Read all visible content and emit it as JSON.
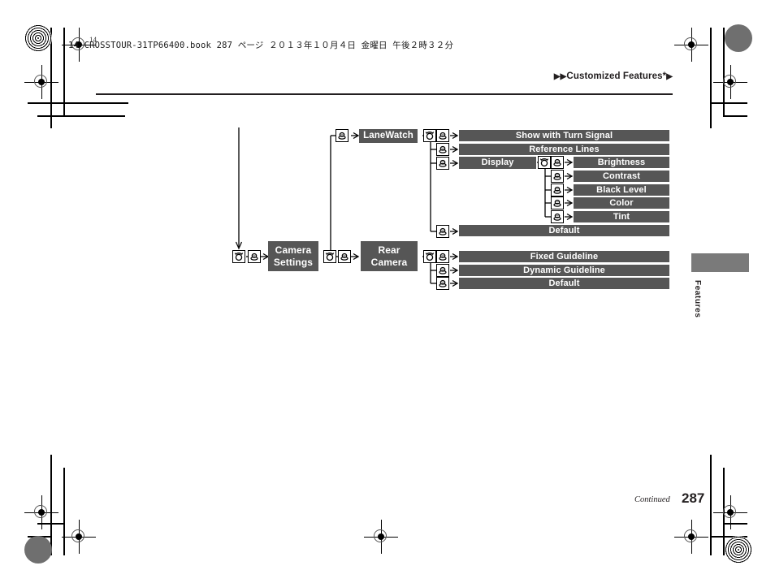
{
  "page": {
    "filestamp": "14 CROSSTOUR-31TP66400.book   287 ページ   ２０１３年１０月４日   金曜日   午後２時３２分",
    "corner_number": "14",
    "header_title": "Customized Features",
    "header_asterisk": "*",
    "header_prefix_arrows": "▶▶",
    "header_suffix_arrow": "▶",
    "side_tab_label": "Features",
    "continued_label": "Continued",
    "page_number": "287"
  },
  "colors": {
    "node_fill": "#565656",
    "node_text": "#ffffff",
    "rule": "#231f20",
    "tab_fill": "#7a7a7a",
    "line": "#000000"
  },
  "diagram": {
    "type": "menu-flow-tree",
    "icons": {
      "rotate": "rotate-knob-icon",
      "press": "press-knob-icon"
    },
    "nodes": {
      "camera_settings": "Camera\nSettings",
      "camera_settings_line1": "Camera",
      "camera_settings_line2": "Settings",
      "lanewatch": "LaneWatch",
      "rear_camera_line1": "Rear",
      "rear_camera_line2": "Camera",
      "display": "Display"
    },
    "lanewatch_items": [
      "Show with Turn Signal",
      "Reference Lines",
      "Display",
      "Default"
    ],
    "display_items": [
      "Brightness",
      "Contrast",
      "Black Level",
      "Color",
      "Tint"
    ],
    "rear_camera_items": [
      "Fixed Guideline",
      "Dynamic Guideline",
      "Default"
    ]
  }
}
